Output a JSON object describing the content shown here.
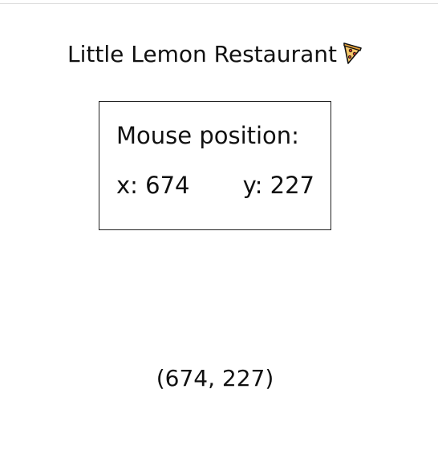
{
  "header": {
    "title": "Little Lemon Restaurant",
    "icon": "pizza-icon"
  },
  "mouse_panel": {
    "heading": "Mouse position:",
    "x_label": "x: 674",
    "y_label": "y: 227"
  },
  "coordinates": {
    "text": "(674, 227)"
  },
  "colors": {
    "border": "#222222",
    "text": "#111111",
    "pizza_crust": "#e8a33a",
    "pizza_cheese": "#f6c86a",
    "pizza_pepperoni": "#c0392b"
  }
}
